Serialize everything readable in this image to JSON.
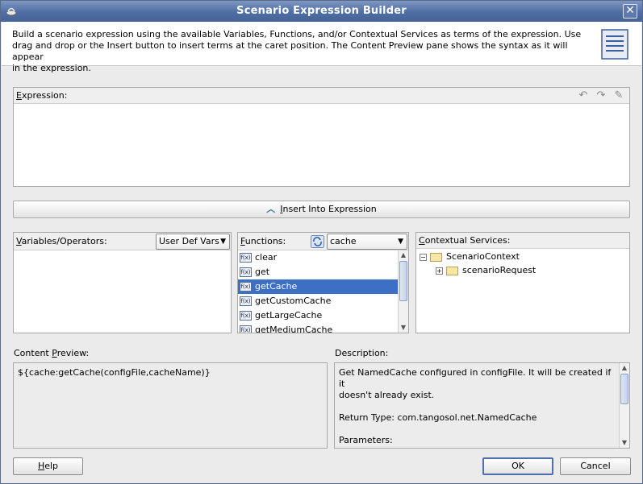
{
  "window": {
    "title": "Scenario Expression Builder",
    "close": "✕"
  },
  "header": {
    "description_lines": [
      "Build a scenario expression using the available Variables, Functions, and/or Contextual Services as terms of the expression. Use",
      "drag and drop or the Insert button to insert terms at the caret position. The Content Preview pane shows the syntax as it will appear",
      "in the expression."
    ]
  },
  "expression": {
    "label_first": "E",
    "label_rest": "xpression:",
    "icons": [
      "undo-icon",
      "redo-icon",
      "eraser-icon"
    ]
  },
  "insert": {
    "label_first": "I",
    "label_rest": "nsert Into Expression"
  },
  "variables": {
    "label_first": "V",
    "label_rest": "ariables/Operators:",
    "combo_value": "User Def Vars"
  },
  "functions": {
    "label_first": "F",
    "label_rest": "unctions:",
    "combo_value": "cache",
    "icon_text": "f(x)",
    "items": [
      "clear",
      "get",
      "getCache",
      "getCustomCache",
      "getLargeCache",
      "getMediumCache"
    ],
    "selected_index": 2
  },
  "contextual": {
    "label_first": "C",
    "label_rest": "ontextual Services:",
    "tree": [
      {
        "label": "ScenarioContext",
        "expander": "−"
      },
      {
        "label": "scenarioRequest",
        "expander": "+"
      }
    ]
  },
  "preview": {
    "label_before": "Content ",
    "label_underlined": "P",
    "label_after": "review:",
    "value": "${cache:getCache(configFile,cacheName)}"
  },
  "description": {
    "label": "Description:",
    "lines": [
      "Get NamedCache configured in configFile.  It will be created if it",
      "doesn't already exist.",
      "",
      "Return Type: com.tangosol.net.NamedCache",
      "",
      "Parameters:"
    ]
  },
  "buttons": {
    "help_first": "H",
    "help_rest": "elp",
    "ok": "OK",
    "cancel": "Cancel"
  },
  "colors": {
    "titlebar": "#4f6ea3",
    "selection": "#3d6fc4"
  }
}
